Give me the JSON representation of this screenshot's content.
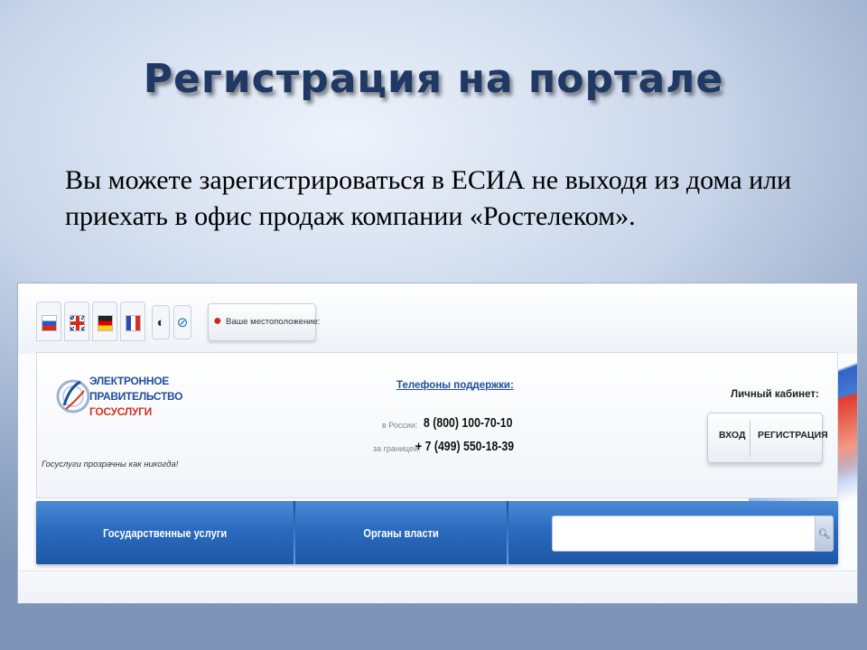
{
  "slide": {
    "title": "Регистрация на портале",
    "body": "Вы можете зарегистрироваться в ЕСИА не выходя из дома или приехать в офис продаж компании «Ростелеком»."
  },
  "portal": {
    "languages": [
      "russian-flag",
      "english-flag",
      "german-flag",
      "french-flag"
    ],
    "accessibility_icons": [
      "contrast-icon",
      "compass-icon"
    ],
    "location": {
      "label": "Ваше местоположение:",
      "value": ""
    },
    "logo": {
      "line1": "ЭЛЕКТРОННОЕ",
      "line2": "ПРАВИТЕЛЬСТВО",
      "line3": "ГОСУСЛУГИ",
      "slogan": "Госуслуги прозрачны как никогда!"
    },
    "support": {
      "title": "Телефоны поддержки:",
      "russia_label": "в России:",
      "russia_number": "8 (800) 100-70-10",
      "abroad_label": "за границей:",
      "abroad_number": "+ 7 (499) 550-18-39"
    },
    "cabinet": {
      "label": "Личный кабинет:",
      "login_button": "ВХОД",
      "register_button": "РЕГИСТРАЦИЯ"
    },
    "nav": {
      "items": [
        "Государственные услуги",
        "Органы власти"
      ],
      "search_value": "",
      "search_icon": "search-icon"
    },
    "colors": {
      "nav_blue": "#2b6bbf",
      "title_navy": "#1f3864",
      "accent_red": "#d4301f"
    }
  }
}
